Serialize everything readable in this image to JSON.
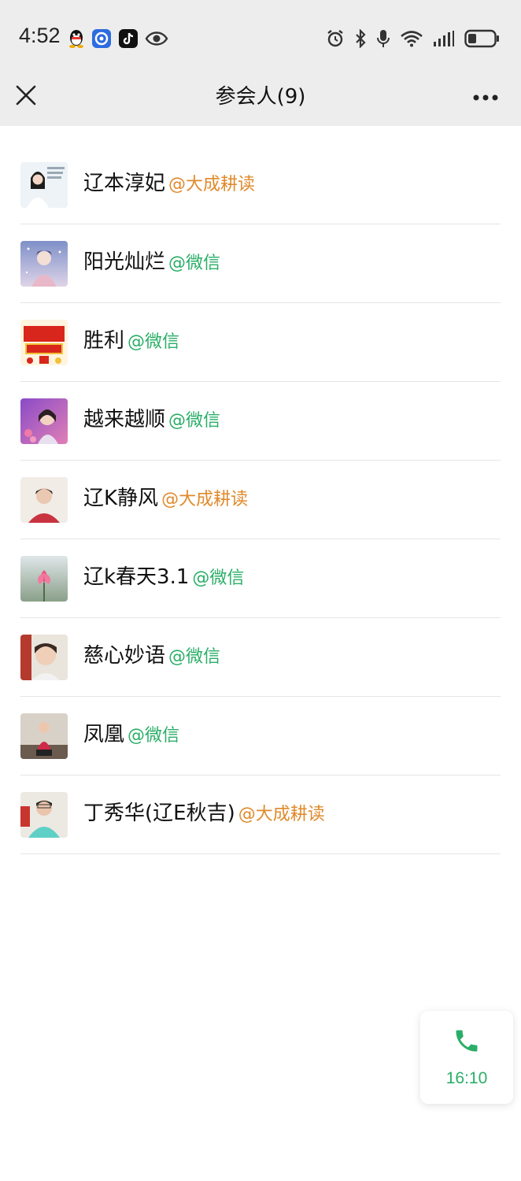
{
  "status_bar": {
    "time": "4:52",
    "left_icons": [
      "qq-icon",
      "blue-app-icon",
      "tiktok-icon",
      "eye-icon"
    ],
    "right_icons": [
      "alarm-icon",
      "bluetooth-icon",
      "mic-icon",
      "wifi-icon",
      "signal-icon",
      "battery-icon"
    ]
  },
  "nav": {
    "title": "参会人(9)"
  },
  "participants": [
    {
      "name": "辽本淳妃",
      "source": "@大成耕读",
      "source_color": "orange"
    },
    {
      "name": "阳光灿烂",
      "source": "@微信",
      "source_color": "green"
    },
    {
      "name": "胜利",
      "source": "@微信",
      "source_color": "green"
    },
    {
      "name": "越来越顺",
      "source": "@微信",
      "source_color": "green"
    },
    {
      "name": "辽K静风",
      "source": "@大成耕读",
      "source_color": "orange"
    },
    {
      "name": "辽k春天3.1",
      "source": "@微信",
      "source_color": "green"
    },
    {
      "name": "慈心妙语",
      "source": "@微信",
      "source_color": "green"
    },
    {
      "name": "凤凰",
      "source": "@微信",
      "source_color": "green"
    },
    {
      "name": "丁秀华(辽E秋吉)",
      "source": "@大成耕读",
      "source_color": "orange"
    }
  ],
  "call": {
    "duration": "16:10"
  },
  "colors": {
    "green": "#2aae67",
    "orange": "#e08a2c",
    "bar_bg": "#ededed"
  }
}
